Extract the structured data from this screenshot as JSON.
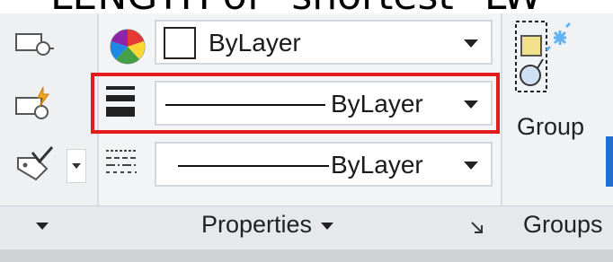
{
  "caption": {
    "text": "LENGTH of \"shortest\" LW"
  },
  "properties_panel": {
    "title": "Properties",
    "color_combo": {
      "value": "ByLayer"
    },
    "lineweight_combo": {
      "value": "ByLayer"
    },
    "linetype_combo": {
      "value": "ByLayer"
    }
  },
  "groups_panel": {
    "title": "Groups",
    "group_button_label": "Group"
  },
  "icons": {
    "color_wheel": "color-wheel-icon",
    "lineweight": "lineweight-icon",
    "linetype": "linetype-icon",
    "group": "group-icon"
  },
  "colors": {
    "highlight": "#e31b1b",
    "accent_blue": "#1e6fd0"
  }
}
